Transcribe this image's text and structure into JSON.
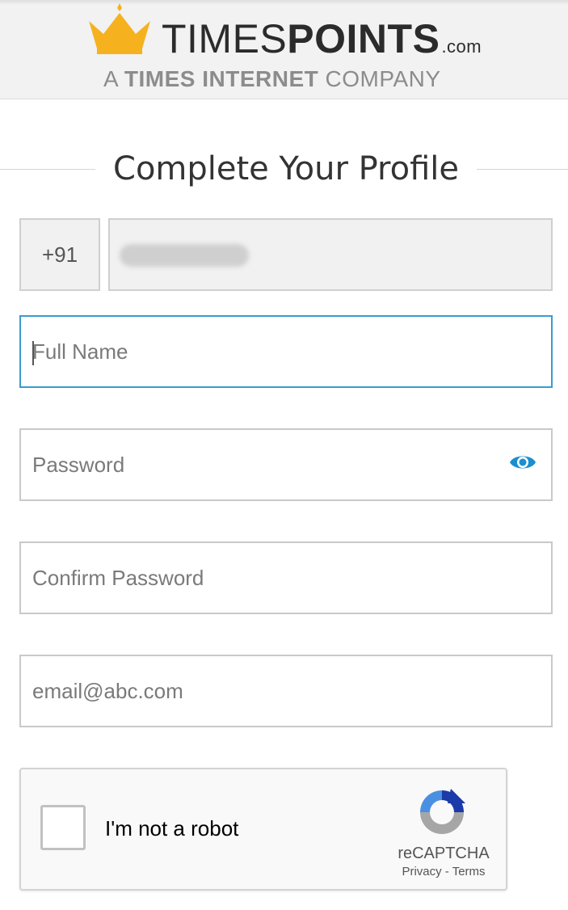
{
  "header": {
    "brand_thin": "TIMES",
    "brand_bold": "POINTS",
    "brand_suffix": ".com",
    "tagline_prefix": "A",
    "tagline_bold": "TIMES INTERNET",
    "tagline_suffix": "COMPANY",
    "crown_color": "#f5b21e"
  },
  "page_title": "Complete Your Profile",
  "form": {
    "country_code": "+91",
    "phone_value": "",
    "full_name_placeholder": "Full Name",
    "password_placeholder": "Password",
    "confirm_password_placeholder": "Confirm Password",
    "email_placeholder": "email@abc.com",
    "password_toggle_icon": "eye-icon",
    "accent_color": "#1a8fcf"
  },
  "recaptcha": {
    "label": "I'm not a robot",
    "brand": "reCAPTCHA",
    "privacy": "Privacy",
    "separator": " - ",
    "terms": "Terms"
  }
}
